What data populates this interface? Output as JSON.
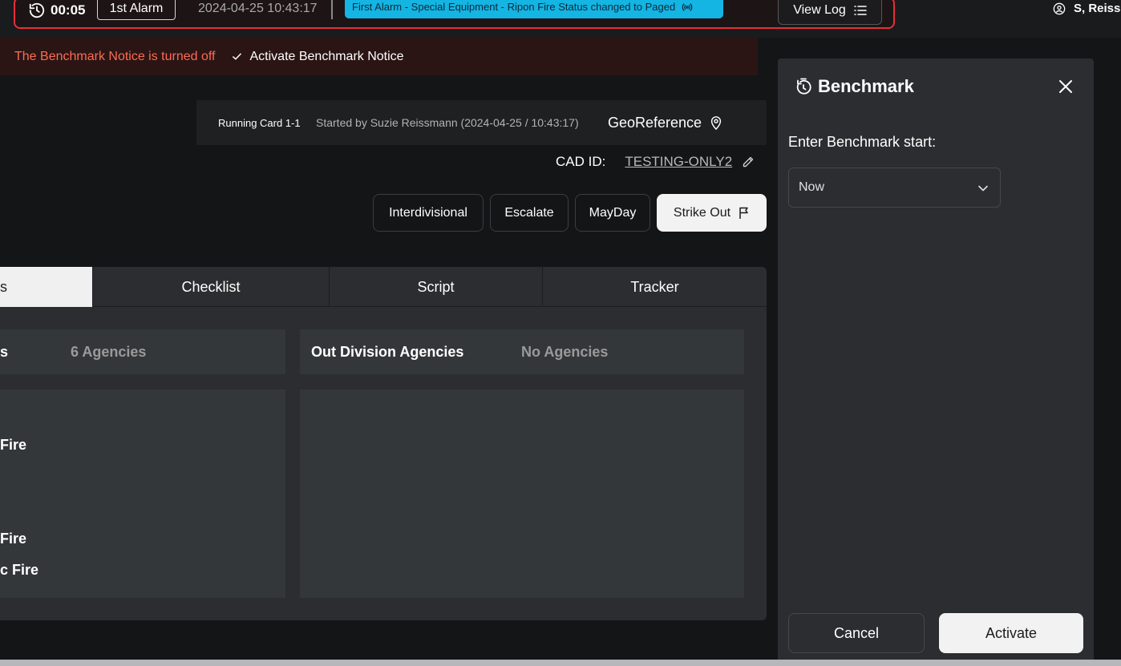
{
  "topbar": {
    "timer": "00:05",
    "alarm_level": "1st Alarm",
    "alarm_datetime": "2024-04-25 10:43:17",
    "status_banner": "First Alarm - Special Equipment - Ripon Fire Status changed to Paged",
    "view_log": "View Log",
    "user_name": "S, Reiss"
  },
  "notice": {
    "text": "The Benchmark Notice is turned off",
    "action": "Activate Benchmark Notice"
  },
  "running_card": {
    "title": "Running Card 1-1",
    "started_by": "Started by Suzie Reissmann (2024-04-25 / 10:43:17)",
    "georeference": "GeoReference"
  },
  "cad": {
    "label": "CAD ID:",
    "value": "TESTING-ONLY2"
  },
  "actions": [
    "Interdivisional",
    "Escalate",
    "MayDay",
    "Strike Out"
  ],
  "tabs": [
    "s",
    "Checklist",
    "Script",
    "Tracker"
  ],
  "in_division": {
    "title": "s",
    "count": "6 Agencies",
    "items": [
      "Fire",
      "Fire",
      "c Fire"
    ]
  },
  "out_division": {
    "title": "Out Division Agencies",
    "count": "No Agencies"
  },
  "benchmark": {
    "title": "Benchmark",
    "field_label": "Enter Benchmark start:",
    "select_value": "Now",
    "cancel": "Cancel",
    "activate": "Activate"
  },
  "colors": {
    "alarm_border": "#e5303a",
    "status_banner": "#14b4e3",
    "notice_text": "#ff6a52",
    "panel": "#2b2d30"
  }
}
